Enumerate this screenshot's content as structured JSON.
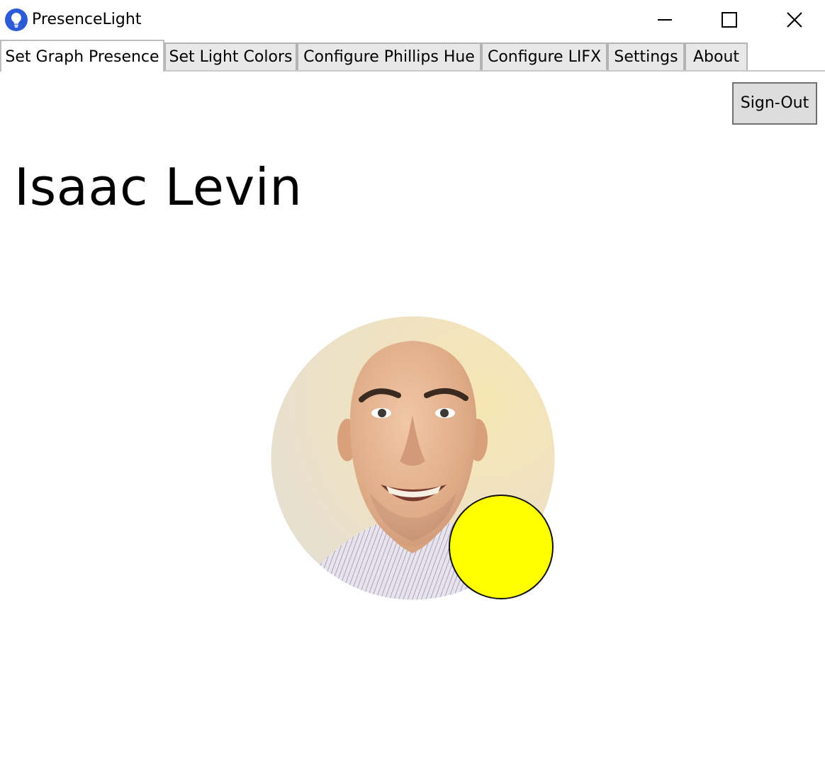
{
  "window": {
    "title": "PresenceLight",
    "controls": [
      "minimize-icon",
      "maximize-icon",
      "close-icon"
    ]
  },
  "tabs": [
    {
      "label": "Set Graph Presence",
      "active": true
    },
    {
      "label": "Set Light Colors",
      "active": false
    },
    {
      "label": "Configure Phillips Hue",
      "active": false
    },
    {
      "label": "Configure LIFX",
      "active": false
    },
    {
      "label": "Settings",
      "active": false
    },
    {
      "label": "About",
      "active": false
    }
  ],
  "graph_presence": {
    "sign_out_label": "Sign-Out",
    "user_name": "Isaac Levin",
    "presence_color": "#FFFF00"
  },
  "colors": {
    "accent_icon": "#2B5BD7",
    "tab_inactive_bg": "#E8E8E8",
    "button_bg": "#DDDDDD"
  }
}
